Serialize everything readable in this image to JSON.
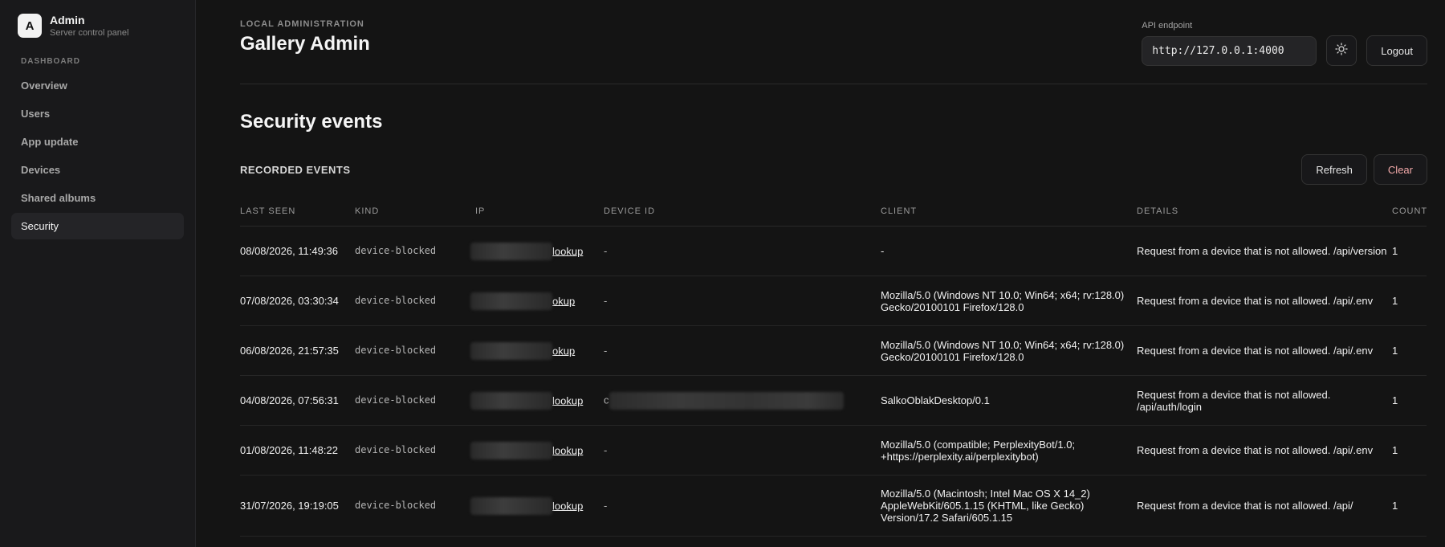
{
  "brand": {
    "logo_letter": "A",
    "title": "Admin",
    "subtitle": "Server control panel"
  },
  "sidebar": {
    "section": "DASHBOARD",
    "items": [
      {
        "label": "Overview",
        "active": false
      },
      {
        "label": "Users",
        "active": false
      },
      {
        "label": "App update",
        "active": false
      },
      {
        "label": "Devices",
        "active": false
      },
      {
        "label": "Shared albums",
        "active": false
      },
      {
        "label": "Security",
        "active": true
      }
    ]
  },
  "header": {
    "eyebrow": "LOCAL ADMINISTRATION",
    "title": "Gallery Admin",
    "api_label": "API endpoint",
    "api_value": "http://127.0.0.1:4000",
    "theme_icon": "sun-icon",
    "logout_label": "Logout"
  },
  "section": {
    "title": "Security events",
    "subtitle": "RECORDED EVENTS",
    "refresh_label": "Refresh",
    "clear_label": "Clear"
  },
  "table": {
    "columns": [
      "LAST SEEN",
      "KIND",
      "IP",
      "DEVICE ID",
      "CLIENT",
      "DETAILS",
      "COUNT"
    ],
    "rows": [
      {
        "last_seen": "08/08/2026, 11:49:36",
        "kind": "device-blocked",
        "ip_link": "lookup",
        "device_id": "-",
        "client": "-",
        "details": "Request from a device that is not allowed. /api/version",
        "count": "1"
      },
      {
        "last_seen": "07/08/2026, 03:30:34",
        "kind": "device-blocked",
        "ip_link": "okup",
        "device_id": "-",
        "client": "Mozilla/5.0 (Windows NT 10.0; Win64; x64; rv:128.0) Gecko/20100101 Firefox/128.0",
        "details": "Request from a device that is not allowed. /api/.env",
        "count": "1"
      },
      {
        "last_seen": "06/08/2026, 21:57:35",
        "kind": "device-blocked",
        "ip_link": "okup",
        "device_id": "-",
        "client": "Mozilla/5.0 (Windows NT 10.0; Win64; x64; rv:128.0) Gecko/20100101 Firefox/128.0",
        "details": "Request from a device that is not allowed. /api/.env",
        "count": "1"
      },
      {
        "last_seen": "04/08/2026, 07:56:31",
        "kind": "device-blocked",
        "ip_link": "lookup",
        "device_id": "c",
        "client": "SalkoOblakDesktop/0.1",
        "details": "Request from a device that is not allowed. /api/auth/login",
        "count": "1"
      },
      {
        "last_seen": "01/08/2026, 11:48:22",
        "kind": "device-blocked",
        "ip_link": "lookup",
        "device_id": "-",
        "client": "Mozilla/5.0 (compatible; PerplexityBot/1.0; +https://perplexity.ai/perplexitybot)",
        "details": "Request from a device that is not allowed. /api/.env",
        "count": "1"
      },
      {
        "last_seen": "31/07/2026, 19:19:05",
        "kind": "device-blocked",
        "ip_link": "lookup",
        "device_id": "-",
        "client": "Mozilla/5.0 (Macintosh; Intel Mac OS X 14_2) AppleWebKit/605.1.15 (KHTML, like Gecko) Version/17.2 Safari/605.1.15",
        "details": "Request from a device that is not allowed. /api/",
        "count": "1"
      }
    ]
  }
}
